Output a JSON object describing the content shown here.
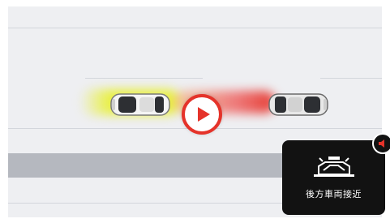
{
  "scene": {
    "icons": {
      "ego_car": "car-top-view-icon",
      "approaching_car": "car-top-view-icon",
      "play": "play-icon",
      "speaker": "speaker-icon",
      "rear_approach": "rear-vehicle-approach-icon"
    },
    "colors": {
      "road": "#eeeff2",
      "lane_line": "#d3d6dc",
      "shoulder": "#b5b8bf",
      "ego_glow": "#e8ef3a",
      "warning": "#e5332a",
      "panel": "#121212"
    }
  },
  "alert": {
    "label": "後方車両接近"
  }
}
